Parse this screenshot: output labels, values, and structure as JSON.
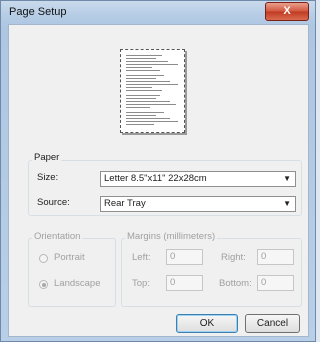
{
  "window": {
    "title": "Page Setup",
    "close_symbol": "X"
  },
  "paper": {
    "group_label": "Paper",
    "size_label": "Size:",
    "size_value": "Letter 8.5\"x11\" 22x28cm",
    "source_label": "Source:",
    "source_value": "Rear Tray"
  },
  "orientation": {
    "group_label": "Orientation",
    "portrait_label": "Portrait",
    "landscape_label": "Landscape",
    "selected": "Landscape"
  },
  "margins": {
    "group_label": "Margins (millimeters)",
    "left_label": "Left:",
    "left_value": "0",
    "right_label": "Right:",
    "right_value": "0",
    "top_label": "Top:",
    "top_value": "0",
    "bottom_label": "Bottom:",
    "bottom_value": "0"
  },
  "buttons": {
    "ok": "OK",
    "cancel": "Cancel"
  },
  "colors": {
    "title_bar": "#b7cde6",
    "close": "#c03a22",
    "dialog_bg": "#f0f0f0"
  }
}
